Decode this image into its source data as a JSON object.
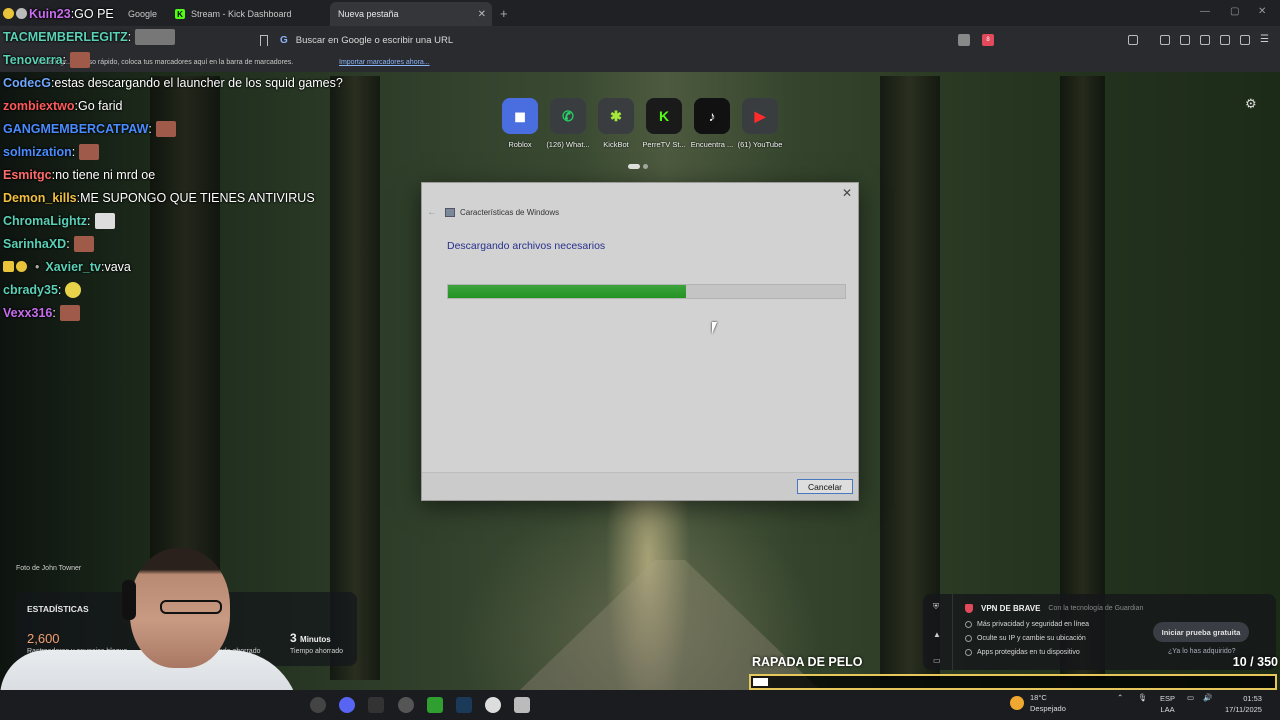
{
  "browser": {
    "tabs": [
      {
        "label": "Google"
      },
      {
        "label": "Stream - Kick Dashboard"
      },
      {
        "label": "Nueva pestaña"
      }
    ],
    "address_placeholder": "Buscar en Google o escribir una URL",
    "bookmarks_hint": "Para logr... acceso rápido, coloca tus marcadores aquí en la barra de marcadores.",
    "bookmarks_link": "Importar marcadores ahora...",
    "brave_badge": "8"
  },
  "chat": [
    {
      "user": "Kuin23",
      "color": "#c86cf0",
      "msg": "GO PE"
    },
    {
      "user": "TACMEMBERLEGITZ",
      "color": "#5ad0b6",
      "msg": ""
    },
    {
      "user": "Tenoverra",
      "color": "#5ad0b6",
      "msg": ""
    },
    {
      "user": "CodecG",
      "color": "#6fa6ff",
      "msg": "estas descargando el launcher de los squid games?"
    },
    {
      "user": "zombiextwo",
      "color": "#ff5a5a",
      "msg": "Go farid"
    },
    {
      "user": "GANGMEMBERCATPAW",
      "color": "#4a8cff",
      "msg": ""
    },
    {
      "user": "solmization",
      "color": "#4a8cff",
      "msg": ""
    },
    {
      "user": "Esmitgc",
      "color": "#ff6a6a",
      "msg": "no tiene ni mrd oe"
    },
    {
      "user": "Demon_kills",
      "color": "#f0c040",
      "msg": "ME SUPONGO QUE TIENES ANTIVIRUS"
    },
    {
      "user": "ChromaLightz",
      "color": "#5ad0b6",
      "msg": ""
    },
    {
      "user": "SarinhaXD",
      "color": "#5ad0b6",
      "msg": ""
    },
    {
      "user": "Xavier_tv",
      "color": "#5ad0b6",
      "msg": "vava"
    },
    {
      "user": "cbrady35",
      "color": "#5ad0b6",
      "msg": ""
    },
    {
      "user": "Vexx316",
      "color": "#c86cf0",
      "msg": ""
    }
  ],
  "speed_dial": [
    {
      "label": "Roblox",
      "icon": "roblox-icon",
      "bg": "#4a6ee0",
      "glyph": "◼"
    },
    {
      "label": "(126) What...",
      "icon": "whatsapp-icon",
      "bg": "#3a3d40",
      "glyph": "✆"
    },
    {
      "label": "KickBot",
      "icon": "kickbot-icon",
      "bg": "#3a3d40",
      "glyph": "✱"
    },
    {
      "label": "PerreTV St...",
      "icon": "kick-icon",
      "bg": "#1a1a1a",
      "glyph": "K"
    },
    {
      "label": "Encuentra ...",
      "icon": "tiktok-icon",
      "bg": "#111111",
      "glyph": "♪"
    },
    {
      "label": "(61) YouTube",
      "icon": "youtube-icon",
      "bg": "#3a3d40",
      "glyph": "▶"
    }
  ],
  "dialog": {
    "title": "Características de Windows",
    "heading": "Descargando archivos necesarios",
    "progress": 0.6,
    "cancel_label": "Cancelar"
  },
  "photo_credit": "Foto de John Towner",
  "stats": {
    "title": "ESTADÍSTICAS",
    "trackers_count": "2,600",
    "trackers_label": "Rastreadores y anuncios bloque...",
    "bandwidth_label": "...nda ahorrado",
    "time_value": "3",
    "time_unit": "Minutos",
    "time_label": "Tiempo ahorrado"
  },
  "vpn": {
    "title": "VPN DE BRAVE",
    "subtitle": "Con la tecnología de Guardian",
    "items": [
      "Más privacidad y seguridad en línea",
      "Oculte su IP y cambie su ubicación",
      "Apps protegidas en tu dispositivo"
    ],
    "button": "Iniciar prueba gratuita",
    "link": "¿Ya lo has adquirido?"
  },
  "goal": {
    "title": "RAPADA DE PELO",
    "current": "10",
    "total": "350",
    "separator": "/",
    "progress": 0.0286
  },
  "taskbar": {
    "weather_temp": "18°C",
    "weather_desc": "Despejado",
    "lang1": "ESP",
    "lang2": "LAA",
    "time": "01:53",
    "date": "17/11/2025"
  },
  "colors": {
    "progress_green": "#2fa02f",
    "goal_border": "#e6c85a",
    "vpn_accent": "#e24a5b"
  }
}
